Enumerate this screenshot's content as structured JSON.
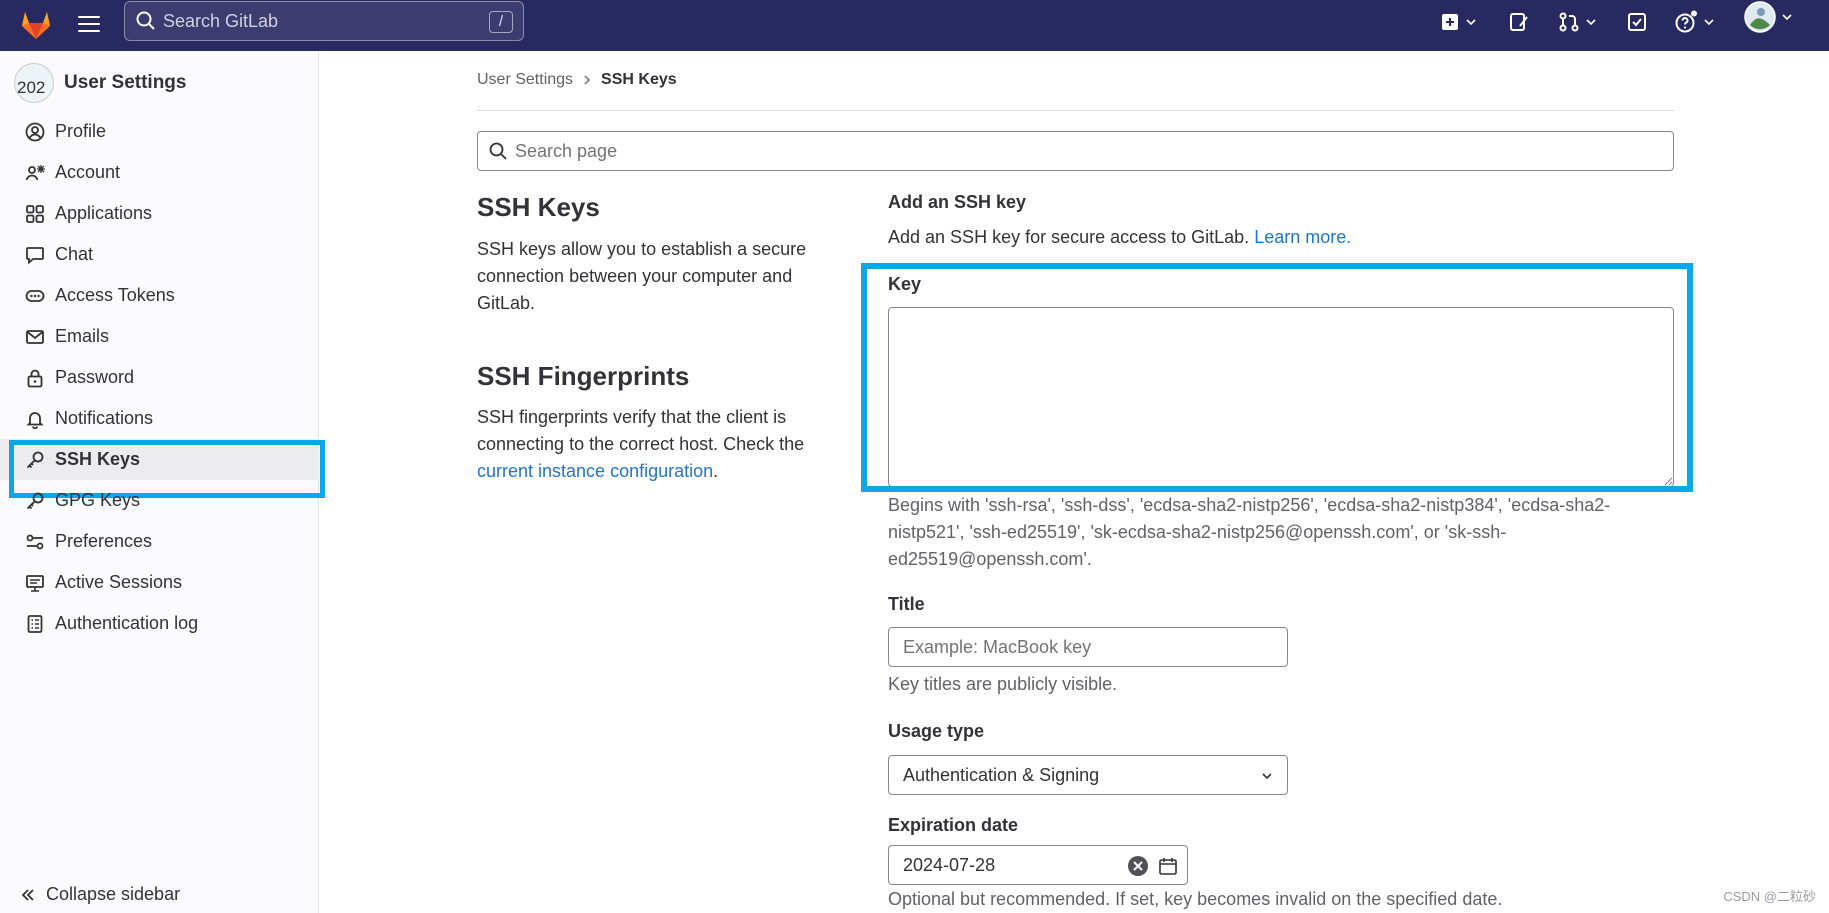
{
  "topbar": {
    "search_placeholder": "Search GitLab",
    "search_shortcut": "/"
  },
  "sidebar": {
    "title": "User Settings",
    "avatar_text": "202",
    "items": [
      {
        "label": "Profile",
        "icon": "user-icon"
      },
      {
        "label": "Account",
        "icon": "account-icon"
      },
      {
        "label": "Applications",
        "icon": "applications-icon"
      },
      {
        "label": "Chat",
        "icon": "chat-icon"
      },
      {
        "label": "Access Tokens",
        "icon": "token-icon"
      },
      {
        "label": "Emails",
        "icon": "mail-icon"
      },
      {
        "label": "Password",
        "icon": "lock-icon"
      },
      {
        "label": "Notifications",
        "icon": "bell-icon"
      },
      {
        "label": "SSH Keys",
        "icon": "key-icon",
        "active": true
      },
      {
        "label": "GPG Keys",
        "icon": "key-icon"
      },
      {
        "label": "Preferences",
        "icon": "preferences-icon"
      },
      {
        "label": "Active Sessions",
        "icon": "monitor-icon"
      },
      {
        "label": "Authentication log",
        "icon": "log-icon"
      }
    ],
    "collapse_label": "Collapse sidebar"
  },
  "breadcrumb": {
    "parent": "User Settings",
    "current": "SSH Keys"
  },
  "page_search_placeholder": "Search page",
  "ssh_section": {
    "title": "SSH Keys",
    "description": "SSH keys allow you to establish a secure connection between your computer and GitLab."
  },
  "fingerprint_section": {
    "title": "SSH Fingerprints",
    "description_prefix": "SSH fingerprints verify that the client is connecting to the correct host. Check the",
    "link_text": "current instance configuration",
    "description_suffix": "."
  },
  "form": {
    "heading": "Add an SSH key",
    "intro": "Add an SSH key for secure access to GitLab.",
    "learn_more": "Learn more.",
    "key_label": "Key",
    "key_value": "",
    "key_help": "Begins with 'ssh-rsa', 'ssh-dss', 'ecdsa-sha2-nistp256', 'ecdsa-sha2-nistp384', 'ecdsa-sha2-nistp521', 'ssh-ed25519', 'sk-ecdsa-sha2-nistp256@openssh.com', or 'sk-ssh-ed25519@openssh.com'.",
    "title_label": "Title",
    "title_placeholder": "Example: MacBook key",
    "title_help": "Key titles are publicly visible.",
    "usage_label": "Usage type",
    "usage_value": "Authentication & Signing",
    "expiration_label": "Expiration date",
    "expiration_value": "2024-07-28",
    "expiration_help": "Optional but recommended. If set, key becomes invalid on the specified date."
  },
  "watermark": "CSDN @二粒砂",
  "colors": {
    "topbar": "#292961",
    "highlight": "#0ea5e9",
    "link": "#1f75cb"
  }
}
